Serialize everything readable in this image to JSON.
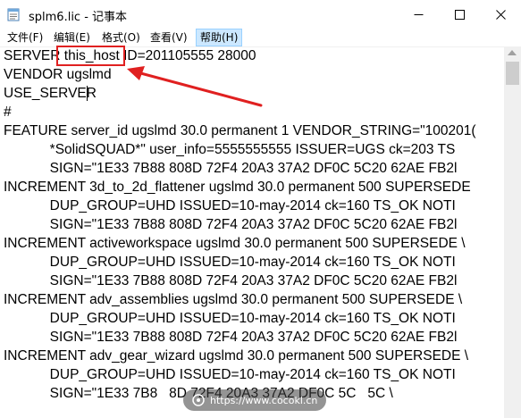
{
  "window": {
    "title": "splm6.lic - 记事本",
    "colors": {
      "annotation": "#e02020",
      "text": "#000000"
    }
  },
  "menu": {
    "items": [
      "文件(F)",
      "编辑(E)",
      "格式(O)",
      "查看(V)",
      "帮助(H)"
    ]
  },
  "editor": {
    "lines": [
      "SERVER this_host ID=201105555 28000",
      "VENDOR ugslmd",
      "USE_SERVER",
      "#",
      "FEATURE server_id ugslmd 30.0 permanent 1 VENDOR_STRING=\"100201(",
      "            *SolidSQUAD*\" user_info=5555555555 ISSUER=UGS ck=203 TS",
      "            SIGN=\"1E33 7B88 808D 72F4 20A3 37A2 DF0C 5C20 62AE FB2l",
      "INCREMENT 3d_to_2d_flattener ugslmd 30.0 permanent 500 SUPERSEDE",
      "            DUP_GROUP=UHD ISSUED=10-may-2014 ck=160 TS_OK NOTI",
      "            SIGN=\"1E33 7B88 808D 72F4 20A3 37A2 DF0C 5C20 62AE FB2l",
      "INCREMENT activeworkspace ugslmd 30.0 permanent 500 SUPERSEDE \\",
      "            DUP_GROUP=UHD ISSUED=10-may-2014 ck=160 TS_OK NOTI",
      "            SIGN=\"1E33 7B88 808D 72F4 20A3 37A2 DF0C 5C20 62AE FB2l",
      "INCREMENT adv_assemblies ugslmd 30.0 permanent 500 SUPERSEDE \\",
      "            DUP_GROUP=UHD ISSUED=10-may-2014 ck=160 TS_OK NOTI",
      "            SIGN=\"1E33 7B88 808D 72F4 20A3 37A2 DF0C 5C20 62AE FB2l",
      "INCREMENT adv_gear_wizard ugslmd 30.0 permanent 500 SUPERSEDE \\",
      "            DUP_GROUP=UHD ISSUED=10-may-2014 ck=160 TS_OK NOTI",
      "            SIGN=\"1E33 7B8   8D 72F4 20A3 37A2 DF0C 5C   5C \\"
    ]
  },
  "watermark": {
    "text": "https://www.cocokl.cn"
  }
}
